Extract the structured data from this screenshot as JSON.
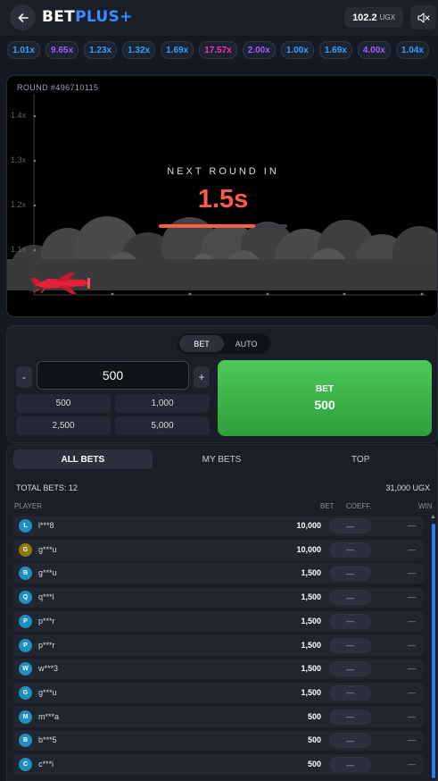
{
  "header": {
    "brand_part1": "BET",
    "brand_part2": "PLUS+",
    "balance_amount": "102.2",
    "balance_currency": "UGX",
    "back_icon": "arrow-left-icon",
    "sound_icon": "speaker-muted-icon"
  },
  "multipliers": [
    {
      "label": "1.01x",
      "tone": "blue"
    },
    {
      "label": "9.65x",
      "tone": "purple"
    },
    {
      "label": "1.23x",
      "tone": "blue"
    },
    {
      "label": "1.32x",
      "tone": "blue"
    },
    {
      "label": "1.69x",
      "tone": "blue"
    },
    {
      "label": "17.57x",
      "tone": "pink"
    },
    {
      "label": "2.00x",
      "tone": "purple"
    },
    {
      "label": "1.00x",
      "tone": "blue"
    },
    {
      "label": "1.69x",
      "tone": "blue"
    },
    {
      "label": "4.00x",
      "tone": "purple"
    },
    {
      "label": "1.04x",
      "tone": "blue"
    }
  ],
  "game": {
    "round_label": "ROUND #496710115",
    "y_ticks": [
      "1.4x",
      "1.3x",
      "1.2x",
      "1.1x"
    ],
    "next_round_title": "NEXT ROUND IN",
    "countdown": "1.5s",
    "countdown_progress": 0.75,
    "accent_color": "#ff5b4a"
  },
  "bet_panel": {
    "mode_bet": "BET",
    "mode_auto": "AUTO",
    "minus": "-",
    "plus": "+",
    "amount": "500",
    "quick_amounts": [
      "500",
      "1,000",
      "2,500",
      "5,000"
    ],
    "bet_button_label": "BET",
    "bet_button_amount": "500",
    "button_color": "#3fb84c"
  },
  "bets": {
    "tabs": [
      "ALL BETS",
      "MY BETS",
      "TOP"
    ],
    "total_label": "TOTAL BETS: 12",
    "total_amount": "31,000 UGX",
    "columns": {
      "player": "PLAYER",
      "bet": "BET",
      "coeff": "COEFF.",
      "win": "WIN"
    },
    "rows": [
      {
        "initial": "L",
        "name": "l***8",
        "bet": "10,000",
        "coeff": "—",
        "win": "—",
        "color": "#1f8fc0"
      },
      {
        "initial": "G",
        "name": "g***u",
        "bet": "10,000",
        "coeff": "—",
        "win": "—",
        "color": "#8c7a0e"
      },
      {
        "initial": "B",
        "name": "g***u",
        "bet": "1,500",
        "coeff": "—",
        "win": "—",
        "color": "#1f8fc0"
      },
      {
        "initial": "Q",
        "name": "q***l",
        "bet": "1,500",
        "coeff": "—",
        "win": "—",
        "color": "#1f8fc0"
      },
      {
        "initial": "P",
        "name": "p***r",
        "bet": "1,500",
        "coeff": "—",
        "win": "—",
        "color": "#1f8fc0"
      },
      {
        "initial": "P",
        "name": "p***r",
        "bet": "1,500",
        "coeff": "—",
        "win": "—",
        "color": "#1f8fc0"
      },
      {
        "initial": "W",
        "name": "w***3",
        "bet": "1,500",
        "coeff": "—",
        "win": "—",
        "color": "#1f8fc0"
      },
      {
        "initial": "G",
        "name": "g***u",
        "bet": "1,500",
        "coeff": "—",
        "win": "—",
        "color": "#1f8fc0"
      },
      {
        "initial": "M",
        "name": "m***a",
        "bet": "500",
        "coeff": "—",
        "win": "—",
        "color": "#1f8fc0"
      },
      {
        "initial": "B",
        "name": "b***5",
        "bet": "500",
        "coeff": "—",
        "win": "—",
        "color": "#1f8fc0"
      },
      {
        "initial": "C",
        "name": "c***i",
        "bet": "500",
        "coeff": "—",
        "win": "—",
        "color": "#1f8fc0"
      }
    ]
  }
}
